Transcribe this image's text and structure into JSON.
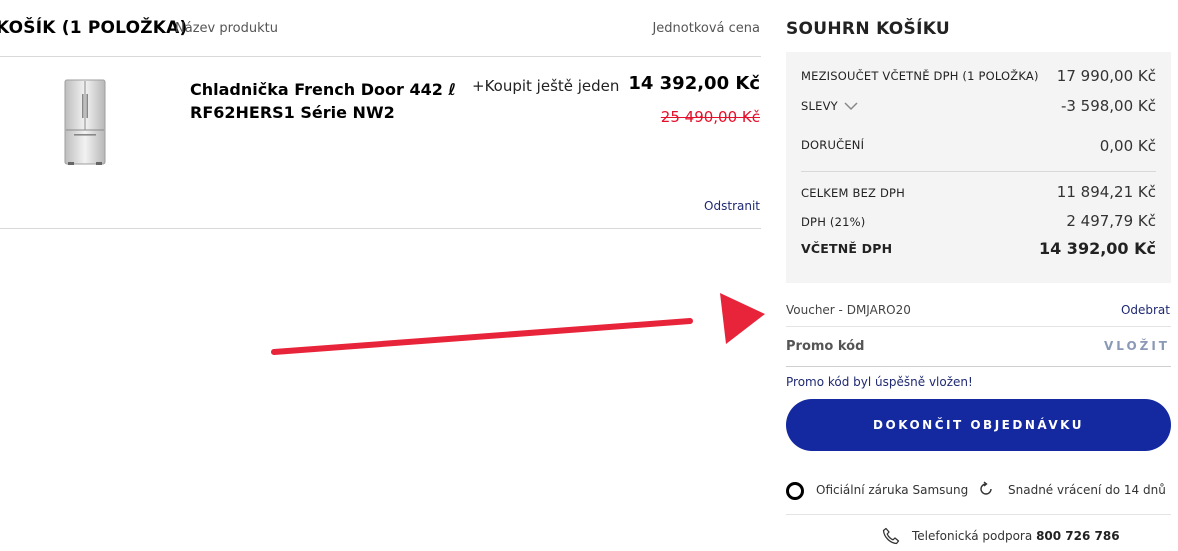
{
  "cart": {
    "title": "KOŠÍK (1 POLOŽKA)",
    "col_product": "Název produktu",
    "col_unit_price": "Jednotková cena",
    "item": {
      "name": "Chladnička French Door 442 ℓ RF62HERS1 Série NW2",
      "buy_another": "+Koupit ještě jeden",
      "price": "14 392,00 Kč",
      "old_price": "25 490,00 Kč",
      "remove": "Odstranit",
      "image_icon": "fridge-icon"
    }
  },
  "summary": {
    "title": "SOUHRN KOŠÍKU",
    "subtotal_label": "MEZISOUČET VČETNĚ DPH (1 POLOŽKA)",
    "subtotal_value": "17 990,00 Kč",
    "discount_label": "SLEVY",
    "discount_value": "-3 598,00 Kč",
    "delivery_label": "DORUČENÍ",
    "delivery_value": "0,00 Kč",
    "net_label": "CELKEM BEZ DPH",
    "net_value": "11 894,21 Kč",
    "vat_label": "DPH (21%)",
    "vat_value": "2 497,79 Kč",
    "total_label": "VČETNĚ DPH",
    "total_value": "14 392,00 Kč"
  },
  "voucher": {
    "label": "Voucher - DMJARO20",
    "remove": "Odebrat"
  },
  "promo": {
    "placeholder": "Promo kód",
    "apply": "VLOŽIT",
    "success": "Promo kód byl úspěšně vložen!"
  },
  "checkout": {
    "label": "DOKONČIT OBJEDNÁVKU"
  },
  "features": {
    "warranty": "Oficiální záruka Samsung",
    "returns": "Snadné vrácení do 14 dnů"
  },
  "support": {
    "label": "Telefonická podpora",
    "phone": "800 726 786"
  },
  "colors": {
    "accent": "#1428a0",
    "link": "#1f2a72",
    "old_price": "#e3112b",
    "annotation_arrow": "#e8243a"
  }
}
